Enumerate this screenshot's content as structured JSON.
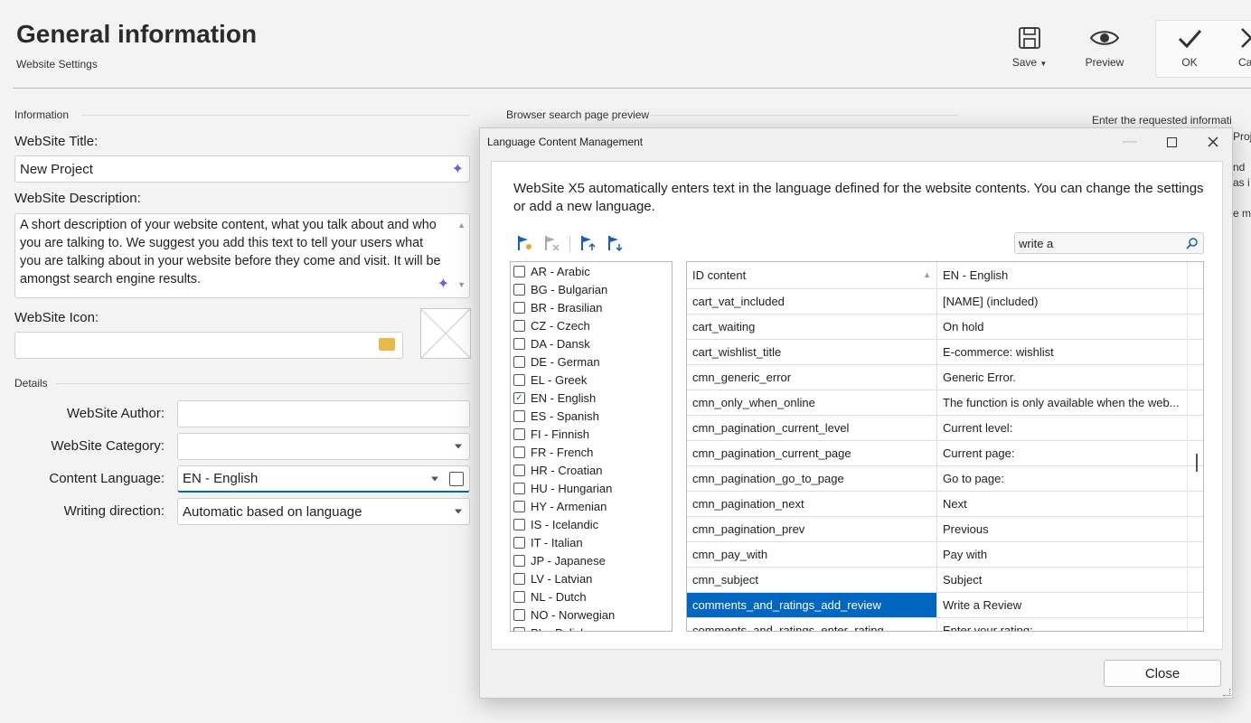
{
  "header": {
    "app_title_fragment": "",
    "title": "General information",
    "subtitle": "Website Settings",
    "save_label": "Save",
    "preview_label": "Preview",
    "ok_label": "OK",
    "cancel_label": "Ca"
  },
  "info_section": {
    "label": "Information",
    "title_label": "WebSite Title:",
    "title_value": "New Project",
    "description_label": "WebSite Description:",
    "description_value": "A short description of your website content, what you talk about and who you are talking to. We suggest you add  this text to tell your users what you are talking about in your website before they come and visit. It will be amongst search engine results.",
    "icon_label": "WebSite Icon:",
    "icon_value": ""
  },
  "details_section": {
    "label": "Details",
    "author_label": "WebSite Author:",
    "author_value": "",
    "category_label": "WebSite Category:",
    "category_value": "",
    "language_label": "Content Language:",
    "language_value": "EN - English",
    "direction_label": "Writing direction:",
    "direction_value": "Automatic based on language"
  },
  "preview_section": {
    "label": "Browser search page preview"
  },
  "help_panel": {
    "line1": "Enter the requested informati",
    "line2": "Proj",
    "line3": "nd",
    "line4": "as i",
    "line5": "e m"
  },
  "dialog": {
    "title": "Language Content Management",
    "description": "WebSite X5 automatically enters text in the language defined for the website contents. You can change the settings or add a new language.",
    "search_value": "write a",
    "close_label": "Close",
    "languages": [
      {
        "label": "AR - Arabic",
        "checked": false
      },
      {
        "label": "BG - Bulgarian",
        "checked": false
      },
      {
        "label": "BR - Brasilian",
        "checked": false
      },
      {
        "label": "CZ - Czech",
        "checked": false
      },
      {
        "label": "DA - Dansk",
        "checked": false
      },
      {
        "label": "DE - German",
        "checked": false
      },
      {
        "label": "EL - Greek",
        "checked": false
      },
      {
        "label": "EN - English",
        "checked": true
      },
      {
        "label": "ES - Spanish",
        "checked": false
      },
      {
        "label": "FI - Finnish",
        "checked": false
      },
      {
        "label": "FR - French",
        "checked": false
      },
      {
        "label": "HR - Croatian",
        "checked": false
      },
      {
        "label": "HU - Hungarian",
        "checked": false
      },
      {
        "label": "HY - Armenian",
        "checked": false
      },
      {
        "label": "IS - Icelandic",
        "checked": false
      },
      {
        "label": "IT - Italian",
        "checked": false
      },
      {
        "label": "JP - Japanese",
        "checked": false
      },
      {
        "label": "LV - Latvian",
        "checked": false
      },
      {
        "label": "NL - Dutch",
        "checked": false
      },
      {
        "label": "NO - Norwegian",
        "checked": false
      },
      {
        "label": "PL - Polish",
        "checked": false
      }
    ],
    "grid": {
      "col1_header": "ID content",
      "col2_header": "EN - English",
      "rows": [
        {
          "id": "cart_vat_included",
          "value": "[NAME] (included)",
          "selected": false
        },
        {
          "id": "cart_waiting",
          "value": "On hold",
          "selected": false
        },
        {
          "id": "cart_wishlist_title",
          "value": "E-commerce: wishlist",
          "selected": false
        },
        {
          "id": "cmn_generic_error",
          "value": "Generic Error.",
          "selected": false
        },
        {
          "id": "cmn_only_when_online",
          "value": "The function is only available when the web...",
          "selected": false
        },
        {
          "id": "cmn_pagination_current_level",
          "value": "Current level:",
          "selected": false
        },
        {
          "id": "cmn_pagination_current_page",
          "value": "Current page:",
          "selected": false
        },
        {
          "id": "cmn_pagination_go_to_page",
          "value": "Go to page:",
          "selected": false
        },
        {
          "id": "cmn_pagination_next",
          "value": "Next",
          "selected": false
        },
        {
          "id": "cmn_pagination_prev",
          "value": "Previous",
          "selected": false
        },
        {
          "id": "cmn_pay_with",
          "value": "Pay with",
          "selected": false
        },
        {
          "id": "cmn_subject",
          "value": "Subject",
          "selected": false
        },
        {
          "id": "comments_and_ratings_add_review",
          "value": "Write a Review",
          "selected": true
        },
        {
          "id": "comments_and_ratings_enter_rating",
          "value": "Enter your rating:",
          "selected": false
        }
      ]
    }
  }
}
